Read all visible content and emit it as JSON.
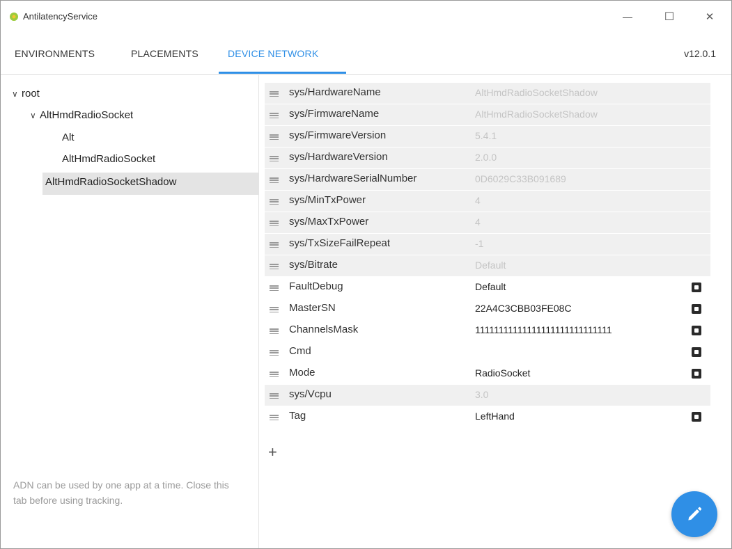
{
  "window": {
    "title": "AntilatencyService",
    "minimize_glyph": "—",
    "maximize_glyph": "☐",
    "close_glyph": "✕",
    "accent_color": "#2f8fe6"
  },
  "tabs": [
    {
      "label": "ENVIRONMENTS"
    },
    {
      "label": "PLACEMENTS"
    },
    {
      "label": "DEVICE NETWORK",
      "active": true
    }
  ],
  "version": "v12.0.1",
  "tree": [
    {
      "label": "root"
    },
    {
      "label": "AltHmdRadioSocket"
    },
    {
      "label": "Alt"
    },
    {
      "label": "AltHmdRadioSocket"
    },
    {
      "label": "AltHmdRadioSocketShadow",
      "selected": true
    }
  ],
  "note": "ADN can be used by one app at a time. Close this tab before using tracking.",
  "properties": [
    {
      "key": "sys/HardwareName",
      "value": "AltHmdRadioSocketShadow",
      "editable": false
    },
    {
      "key": "sys/FirmwareName",
      "value": "AltHmdRadioSocketShadow",
      "editable": false
    },
    {
      "key": "sys/FirmwareVersion",
      "value": "5.4.1",
      "editable": false
    },
    {
      "key": "sys/HardwareVersion",
      "value": "2.0.0",
      "editable": false
    },
    {
      "key": "sys/HardwareSerialNumber",
      "value": "0D6029C33B091689",
      "editable": false
    },
    {
      "key": "sys/MinTxPower",
      "value": "4",
      "editable": false
    },
    {
      "key": "sys/MaxTxPower",
      "value": "4",
      "editable": false
    },
    {
      "key": "sys/TxSizeFailRepeat",
      "value": "-1",
      "editable": false
    },
    {
      "key": "sys/Bitrate",
      "value": "Default",
      "editable": false
    },
    {
      "key": "FaultDebug",
      "value": "Default",
      "editable": true
    },
    {
      "key": "MasterSN",
      "value": "22A4C3CBB03FE08C",
      "editable": true
    },
    {
      "key": "ChannelsMask",
      "value": "11111111111111111111111111111",
      "editable": true
    },
    {
      "key": "Cmd",
      "value": "",
      "editable": true
    },
    {
      "key": "Mode",
      "value": "RadioSocket",
      "editable": true
    },
    {
      "key": "sys/Vcpu",
      "value": "3.0",
      "editable": false
    },
    {
      "key": "Tag",
      "value": "LeftHand",
      "editable": true
    }
  ],
  "add_label": "+"
}
